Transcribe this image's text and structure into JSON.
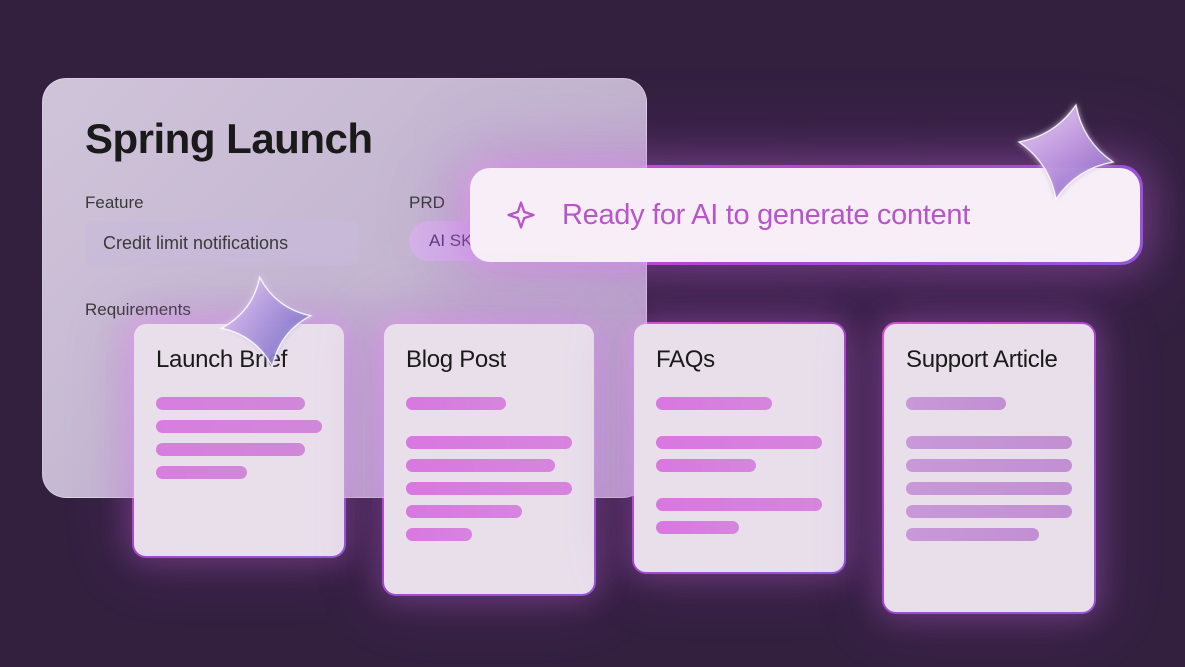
{
  "panel": {
    "title": "Spring Launch",
    "feature_label": "Feature",
    "feature_value": "Credit limit notifications",
    "prd_label": "PRD",
    "prd_chip": "AI SKU",
    "requirements_label": "Requirements"
  },
  "banner": {
    "text": "Ready for AI to generate content"
  },
  "cards": [
    {
      "title": "Launch Brief"
    },
    {
      "title": "Blog Post"
    },
    {
      "title": "FAQs"
    },
    {
      "title": "Support Article"
    }
  ]
}
